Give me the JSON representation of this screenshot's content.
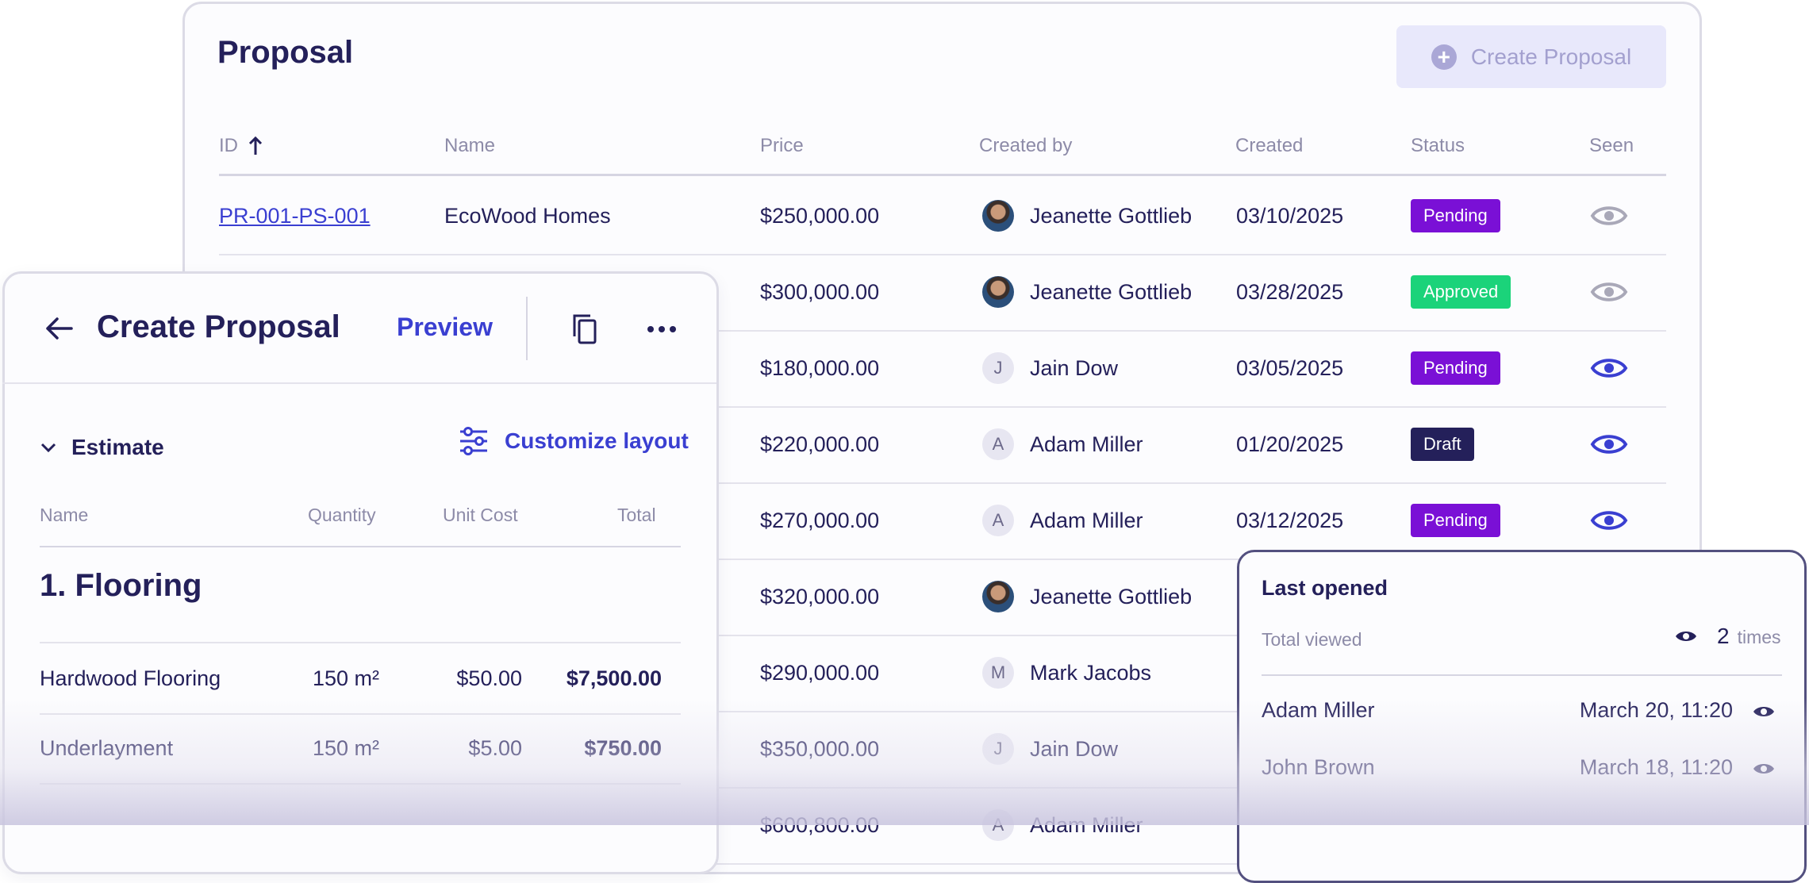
{
  "proposal_table": {
    "title": "Proposal",
    "create_button": "Create Proposal",
    "columns": {
      "id": "ID",
      "name": "Name",
      "price": "Price",
      "created_by": "Created by",
      "created": "Created",
      "status": "Status",
      "seen": "Seen"
    },
    "sort_icon": "arrow-up-icon",
    "rows": [
      {
        "id": "PR-001-PS-001",
        "name": "EcoWood Homes",
        "price": "$250,000.00",
        "created_by": "Jeanette Gottlieb",
        "avatar": "photo",
        "created": "03/10/2025",
        "status": "Pending",
        "seen": false
      },
      {
        "id": "",
        "name": "",
        "price": "$300,000.00",
        "created_by": "Jeanette Gottlieb",
        "avatar": "photo",
        "created": "03/28/2025",
        "status": "Approved",
        "seen": false
      },
      {
        "id": "",
        "name": "",
        "price": "$180,000.00",
        "created_by": "Jain Dow",
        "avatar": "J",
        "created": "03/05/2025",
        "status": "Pending",
        "seen": true
      },
      {
        "id": "",
        "name": "",
        "price": "$220,000.00",
        "created_by": "Adam Miller",
        "avatar": "A",
        "created": "01/20/2025",
        "status": "Draft",
        "seen": true
      },
      {
        "id": "",
        "name": "",
        "price": "$270,000.00",
        "created_by": "Adam Miller",
        "avatar": "A",
        "created": "03/12/2025",
        "status": "Pending",
        "seen": true
      },
      {
        "id": "",
        "name": "",
        "price": "$320,000.00",
        "created_by": "Jeanette Gottlieb",
        "avatar": "photo",
        "created": "",
        "status": "",
        "seen": null
      },
      {
        "id": "",
        "name": "",
        "price": "$290,000.00",
        "created_by": "Mark Jacobs",
        "avatar": "M",
        "created": "",
        "status": "",
        "seen": null
      },
      {
        "id": "",
        "name": "",
        "price": "$350,000.00",
        "created_by": "Jain Dow",
        "avatar": "J",
        "created": "",
        "status": "",
        "seen": null
      },
      {
        "id": "",
        "name": "",
        "price": "$600,800.00",
        "created_by": "Adam Miller",
        "avatar": "A",
        "created": "",
        "status": "",
        "seen": null
      }
    ],
    "status_colors": {
      "Pending": "#7a10d6",
      "Approved": "#1bd37a",
      "Draft": "#24205a"
    },
    "eye_colors": {
      "seen": "#3a3fd1",
      "unseen": "#a9a8b8"
    }
  },
  "create_panel": {
    "back_icon": "arrow-left-icon",
    "title": "Create Proposal",
    "preview": "Preview",
    "copy_icon": "copy-icon",
    "more_icon": "more-horizontal-icon",
    "section": "Estimate",
    "customize": "Customize layout",
    "columns": {
      "name": "Name",
      "quantity": "Quantity",
      "unit_cost": "Unit Cost",
      "total": "Total"
    },
    "group_title": "1. Flooring",
    "items": [
      {
        "name": "Hardwood Flooring",
        "quantity": "150 m²",
        "unit_cost": "$50.00",
        "total": "$7,500.00"
      },
      {
        "name": "Underlayment",
        "quantity": "150 m²",
        "unit_cost": "$5.00",
        "total": "$750.00"
      }
    ]
  },
  "last_opened": {
    "title": "Last opened",
    "total_label": "Total viewed",
    "total_count": "2",
    "total_unit": "times",
    "entries": [
      {
        "name": "Adam Miller",
        "time": "March 20, 11:20"
      },
      {
        "name": "John Brown",
        "time": "March 18, 11:20"
      }
    ]
  }
}
